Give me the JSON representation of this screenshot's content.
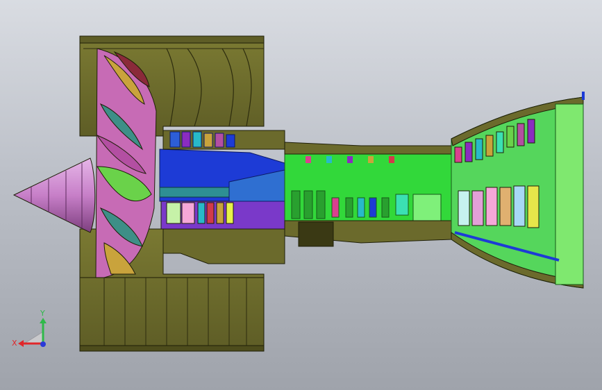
{
  "viewport": {
    "model": "turbofan-engine-cross-section",
    "colors": {
      "casing": "#6b6a2c",
      "casing_dark": "#3a3914",
      "outline": "#1e1e08",
      "spinner": "#c77fc8",
      "blade_pink": "#c76bb5",
      "blade_gold": "#c9a33c",
      "blade_teal": "#3d8f87",
      "lp_blue": "#1d3bd6",
      "hp_green": "#32d83a",
      "nozzle_green": "#55d65c",
      "shaft_teal": "#2e8f93",
      "purple": "#8a2cc0"
    }
  },
  "triad": {
    "x_label": "X",
    "y_label": "Y",
    "x_color": "#e0262a",
    "y_color": "#2fb94a",
    "z_color": "#2a3ad8"
  }
}
